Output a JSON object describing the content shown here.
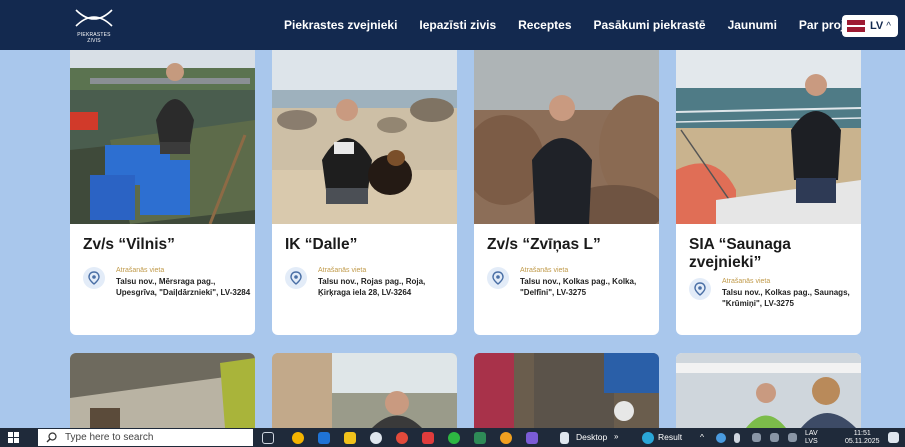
{
  "site": {
    "logo_text": "PIEKRASTES ZIVIS"
  },
  "nav": {
    "items": [
      {
        "label": "Piekrastes zvejnieki"
      },
      {
        "label": "Iepazīsti zivis"
      },
      {
        "label": "Receptes"
      },
      {
        "label": "Pasākumi piekrastē"
      },
      {
        "label": "Jaunumi"
      },
      {
        "label": "Par projektu"
      }
    ],
    "language": "LV",
    "language_caret": "^"
  },
  "cards": [
    {
      "title": "Zv/s “Vilnis”",
      "location_label": "Atrašanās vieta",
      "address": "Talsu nov., Mērsraga pag., Upesgrīva, \"Daiļdārznieki\", LV-3284"
    },
    {
      "title": "IK “Dalle”",
      "location_label": "Atrašanās vieta",
      "address": "Talsu nov., Rojas pag., Roja, Ķirķraga iela 28, LV-3264"
    },
    {
      "title": "Zv/s “Zvīņas L”",
      "location_label": "Atrašanās vieta",
      "address": "Talsu nov., Kolkas pag., Kolka, \"Delfīni\", LV-3275"
    },
    {
      "title": "SIA “Saunaga zvejnieki”",
      "location_label": "Atrašanās vieta",
      "address": "Talsu nov., Kolkas pag., Saunags, \"Krūmiņi\", LV-3275"
    }
  ],
  "taskbar": {
    "search_placeholder": "Type here to search",
    "desktop_label": "Desktop",
    "result_label": "Result",
    "lang_top": "LAV",
    "lang_bottom": "LVS",
    "time": "11:51",
    "date": "05.11.2025"
  },
  "colors": {
    "nav_bg": "#13294f",
    "page_bg": "#a9c7ec",
    "accent_gold": "#c09a4a"
  }
}
